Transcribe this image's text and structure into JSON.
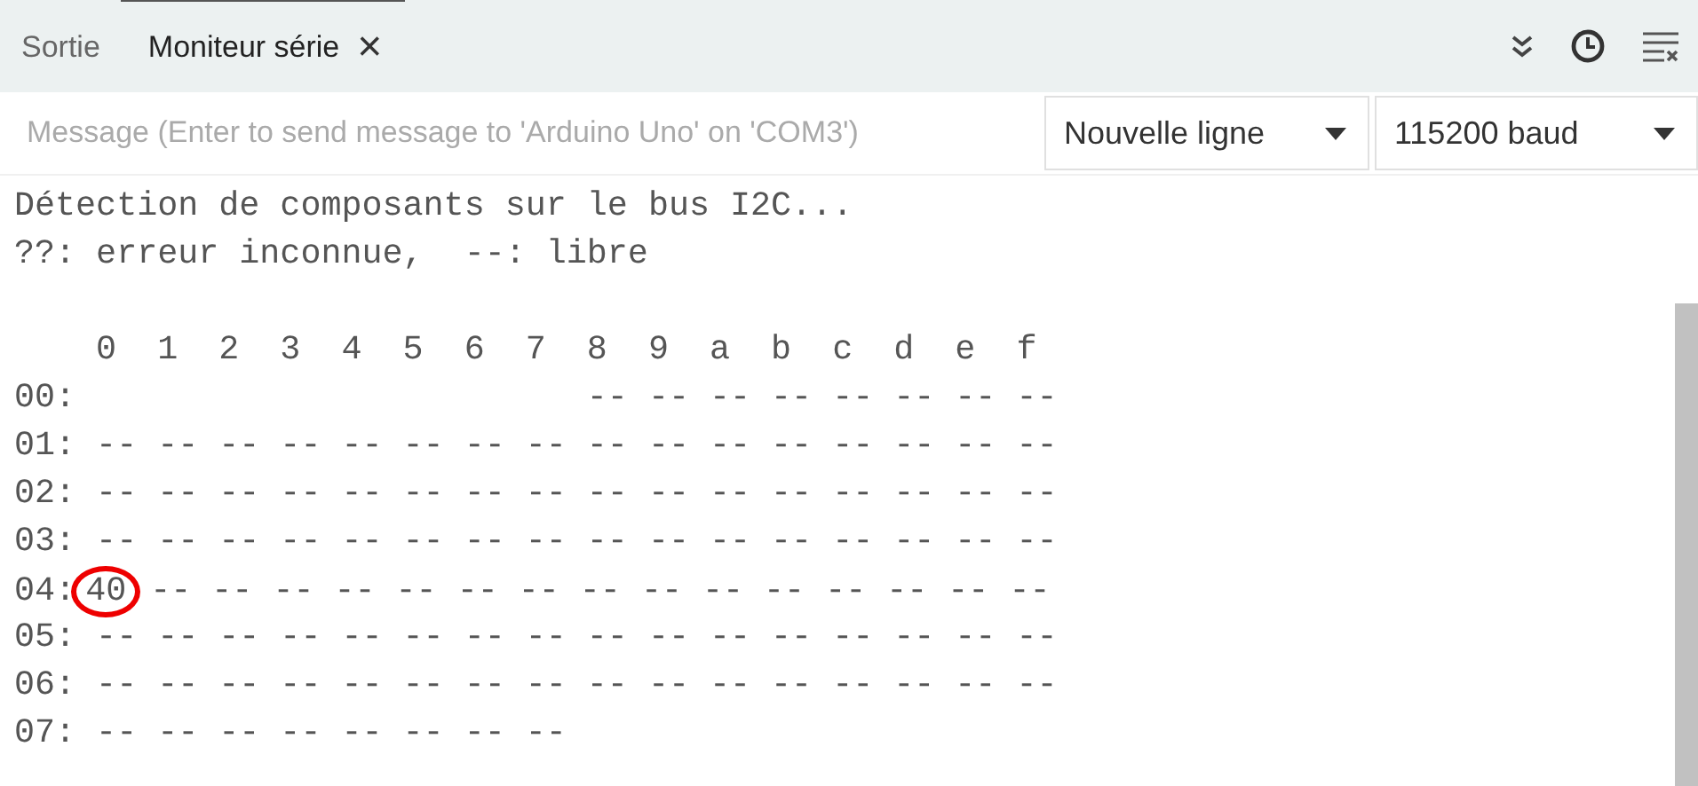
{
  "tabs": [
    {
      "label": "Sortie",
      "selected": false,
      "closable": false
    },
    {
      "label": "Moniteur série",
      "selected": true,
      "closable": true
    }
  ],
  "toolbar": {
    "close_symbol": "×"
  },
  "input": {
    "placeholder": "Message (Enter to send message to 'Arduino Uno' on 'COM3')"
  },
  "selects": [
    {
      "value": "Nouvelle ligne"
    },
    {
      "value": "115200 baud"
    }
  ],
  "output": {
    "intro": [
      "Détection de composants sur le bus I2C...",
      "??: erreur inconnue,  --: libre"
    ],
    "table": [
      {
        "kind": "plain",
        "text": "    0  1  2  3  4  5  6  7  8  9  a  b  c  d  e  f"
      },
      {
        "kind": "plain",
        "text": "00:                         -- -- -- -- -- -- -- --"
      },
      {
        "kind": "plain",
        "text": "01: -- -- -- -- -- -- -- -- -- -- -- -- -- -- -- --"
      },
      {
        "kind": "plain",
        "text": "02: -- -- -- -- -- -- -- -- -- -- -- -- -- -- -- --"
      },
      {
        "kind": "plain",
        "text": "03: -- -- -- -- -- -- -- -- -- -- -- -- -- -- -- --"
      },
      {
        "kind": "circled",
        "label": "04: ",
        "value": "40",
        "rest": " -- -- -- -- -- -- -- -- -- -- -- -- -- -- --"
      },
      {
        "kind": "plain",
        "text": "05: -- -- -- -- -- -- -- -- -- -- -- -- -- -- -- --"
      },
      {
        "kind": "plain",
        "text": "06: -- -- -- -- -- -- -- -- -- -- -- -- -- -- -- --"
      },
      {
        "kind": "plain",
        "text": "07: -- -- -- -- -- -- -- --"
      }
    ]
  }
}
